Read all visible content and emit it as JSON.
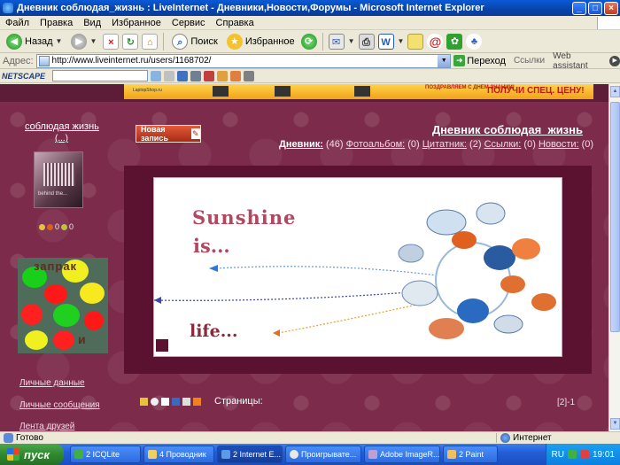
{
  "window": {
    "title": "Дневник соблюдая_жизнь : LiveInternet - Дневники,Новости,Форумы - Microsoft Internet Explorer",
    "min": "_",
    "max": "□",
    "close": "×"
  },
  "menu": [
    "Файл",
    "Правка",
    "Вид",
    "Избранное",
    "Сервис",
    "Справка"
  ],
  "toolbar": {
    "back": "Назад",
    "search": "Поиск",
    "favorites": "Избранное"
  },
  "address": {
    "label": "Адрес:",
    "url": "http://www.liveinternet.ru/users/1168702/",
    "go": "Переход",
    "links": "Ссылки",
    "web_assistant": "Web assistant"
  },
  "nettoolbar": {
    "logo": "NETSCAPE"
  },
  "banner": {
    "ad_text": "ПОЛУЧИ СПЕЦ. ЦЕНУ!",
    "ad_small": "ПОЗДРАВЛЯЕМ С ДНЕМ ЗНАНИЙ!",
    "shop_text": "LaptopShop.ru"
  },
  "page": {
    "username": "соблюдая жизнь",
    "user_sub": "(...)",
    "avatar_caption": "behind the...",
    "avatar_stats": "0",
    "avatar_stats2": "0",
    "paint_text": "запрак",
    "paint_text2": "и",
    "new_post": "Новая запись",
    "diary_title": "Дневник соблюдая_жизнь",
    "nav": {
      "diary": "Дневник:",
      "diary_count": "(46)",
      "photo": "Фотоальбом:",
      "photo_count": "(0)",
      "quote": "Цитатник:",
      "quote_count": "(2)",
      "links": "Ссылки:",
      "links_count": "(0)",
      "news": "Новости:",
      "news_count": "(0)"
    },
    "post_text1": "Sunshine",
    "post_text2": "is...",
    "post_text3": "life...",
    "side_links": [
      "Личные данные",
      "Личные сообщения",
      "Лента друзей"
    ],
    "pages_label": "Страницы:",
    "pager": "[2]-1"
  },
  "status": {
    "done": "Готово",
    "zone": "Интернет"
  },
  "taskbar": {
    "start": "пуск",
    "tasks": [
      {
        "label": "2 ICQLite",
        "active": false
      },
      {
        "label": "4 Проводник",
        "active": false
      },
      {
        "label": "2 Internet E...",
        "active": true
      },
      {
        "label": "Проигрывате...",
        "active": false
      },
      {
        "label": "Adobe ImageR...",
        "active": false
      },
      {
        "label": "2 Paint",
        "active": false
      }
    ],
    "lang": "RU",
    "clock": "19:01"
  }
}
